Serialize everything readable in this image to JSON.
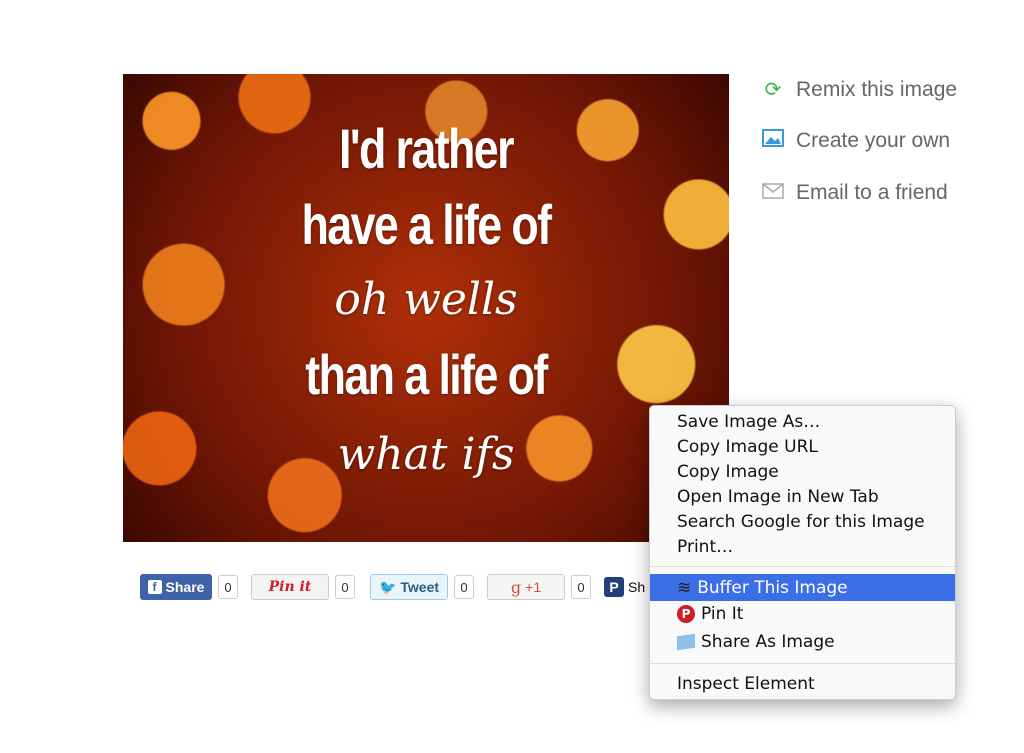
{
  "quote": {
    "lines": [
      "I'd rather",
      "have a life of",
      "oh wells",
      "than a life of",
      "what ifs"
    ]
  },
  "side_links": [
    {
      "label": "Remix this image",
      "icon": "refresh-icon",
      "color": "#3cb34a"
    },
    {
      "label": "Create your own",
      "icon": "image-icon",
      "color": "#3a9ad9"
    },
    {
      "label": "Email to a friend",
      "icon": "envelope-icon",
      "color": "#aaaaaa"
    }
  ],
  "share": {
    "facebook": {
      "label": "Share",
      "count": "0"
    },
    "pinterest": {
      "label": "Pin it",
      "count": "0"
    },
    "twitter": {
      "label": "Tweet",
      "count": "0"
    },
    "gplus": {
      "label": "+1",
      "count": "0"
    },
    "other": {
      "label": "Sh"
    }
  },
  "context_menu": {
    "group1": [
      "Save Image As…",
      "Copy Image URL",
      "Copy Image",
      "Open Image in New Tab",
      "Search Google for this Image",
      "Print…"
    ],
    "group2": [
      {
        "label": "Buffer This Image",
        "icon": "buffer-icon"
      },
      {
        "label": "Pin It",
        "icon": "pinterest-icon"
      },
      {
        "label": "Share As Image",
        "icon": "share-as-image-icon"
      }
    ],
    "group3": [
      "Inspect Element"
    ],
    "highlight_color": "#3b6fe8"
  }
}
